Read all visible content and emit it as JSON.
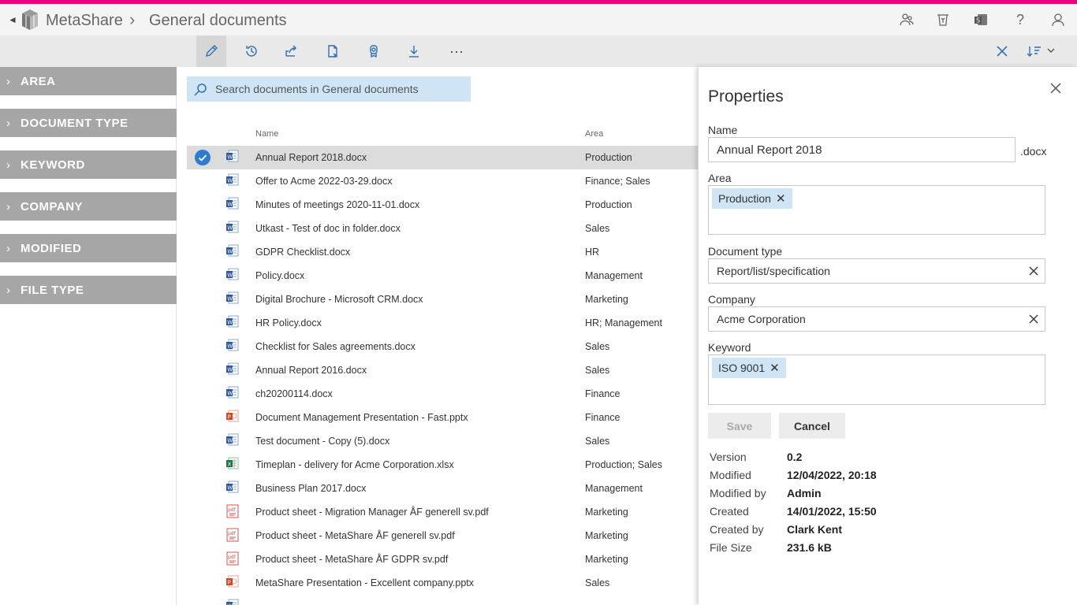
{
  "header": {
    "app_title": "MetaShare",
    "page_title": "General documents",
    "icons": [
      "people-icon",
      "recycle-bin-icon",
      "sharepoint-icon",
      "help-icon",
      "user-icon"
    ]
  },
  "toolbar": {
    "buttons": [
      "edit-icon",
      "history-icon",
      "share-icon",
      "copy-link-icon",
      "badge-icon",
      "download-icon",
      "more-icon"
    ]
  },
  "sidebar": {
    "filters": [
      "AREA",
      "DOCUMENT TYPE",
      "KEYWORD",
      "COMPANY",
      "MODIFIED",
      "FILE TYPE"
    ]
  },
  "search": {
    "placeholder": "Search documents in General documents"
  },
  "table": {
    "columns": {
      "name": "Name",
      "area": "Area"
    },
    "rows": [
      {
        "name": "Annual Report 2018.docx",
        "area": "Production",
        "type": "word",
        "selected": true
      },
      {
        "name": "Offer to Acme 2022-03-29.docx",
        "area": "Finance; Sales",
        "type": "word"
      },
      {
        "name": "Minutes of meetings 2020-11-01.docx",
        "area": "Production",
        "type": "word"
      },
      {
        "name": "Utkast - Test of doc in folder.docx",
        "area": "Sales",
        "type": "word"
      },
      {
        "name": "GDPR Checklist.docx",
        "area": "HR",
        "type": "word"
      },
      {
        "name": "Policy.docx",
        "area": "Management",
        "type": "word"
      },
      {
        "name": "Digital Brochure - Microsoft CRM.docx",
        "area": "Marketing",
        "type": "word"
      },
      {
        "name": "HR Policy.docx",
        "area": "HR; Management",
        "type": "word"
      },
      {
        "name": "Checklist for Sales agreements.docx",
        "area": "Sales",
        "type": "word"
      },
      {
        "name": "Annual Report 2016.docx",
        "area": "Sales",
        "type": "word"
      },
      {
        "name": "ch20200114.docx",
        "area": "Finance",
        "type": "word"
      },
      {
        "name": "Document Management Presentation - Fast.pptx",
        "area": "Finance",
        "type": "ppt"
      },
      {
        "name": "Test document - Copy (5).docx",
        "area": "Sales",
        "type": "word"
      },
      {
        "name": "Timeplan - delivery for Acme Corporation.xlsx",
        "area": "Production; Sales",
        "type": "excel"
      },
      {
        "name": "Business Plan 2017.docx",
        "area": "Management",
        "type": "word"
      },
      {
        "name": "Product sheet - Migration Manager ÅF generell sv.pdf",
        "area": "Marketing",
        "type": "pdf"
      },
      {
        "name": "Product sheet - MetaShare ÅF generell sv.pdf",
        "area": "Marketing",
        "type": "pdf"
      },
      {
        "name": "Product sheet - MetaShare ÅF GDPR sv.pdf",
        "area": "Marketing",
        "type": "pdf"
      },
      {
        "name": "MetaShare Presentation - Excellent company.pptx",
        "area": "Sales",
        "type": "ppt"
      },
      {
        "name": "",
        "area": "",
        "type": "word"
      }
    ]
  },
  "properties": {
    "title": "Properties",
    "name_label": "Name",
    "name_value": "Annual Report 2018",
    "extension": ".docx",
    "area_label": "Area",
    "area_tags": [
      "Production"
    ],
    "doctype_label": "Document type",
    "doctype_value": "Report/list/specification",
    "company_label": "Company",
    "company_value": "Acme Corporation",
    "keyword_label": "Keyword",
    "keyword_tags": [
      "ISO 9001"
    ],
    "save_label": "Save",
    "cancel_label": "Cancel",
    "meta": [
      {
        "key": "Version",
        "value": "0.2"
      },
      {
        "key": "Modified",
        "value": "12/04/2022, 20:18"
      },
      {
        "key": "Modified by",
        "value": "Admin"
      },
      {
        "key": "Created",
        "value": "14/01/2022, 15:50"
      },
      {
        "key": "Created by",
        "value": "Clark Kent"
      },
      {
        "key": "File Size",
        "value": "231.6 kB"
      }
    ]
  },
  "colors": {
    "accent": "#e5007e",
    "primary_blue": "#2e7bd1",
    "filter_bg": "#a6a6a6",
    "tag_bg": "#cfe4f5"
  }
}
